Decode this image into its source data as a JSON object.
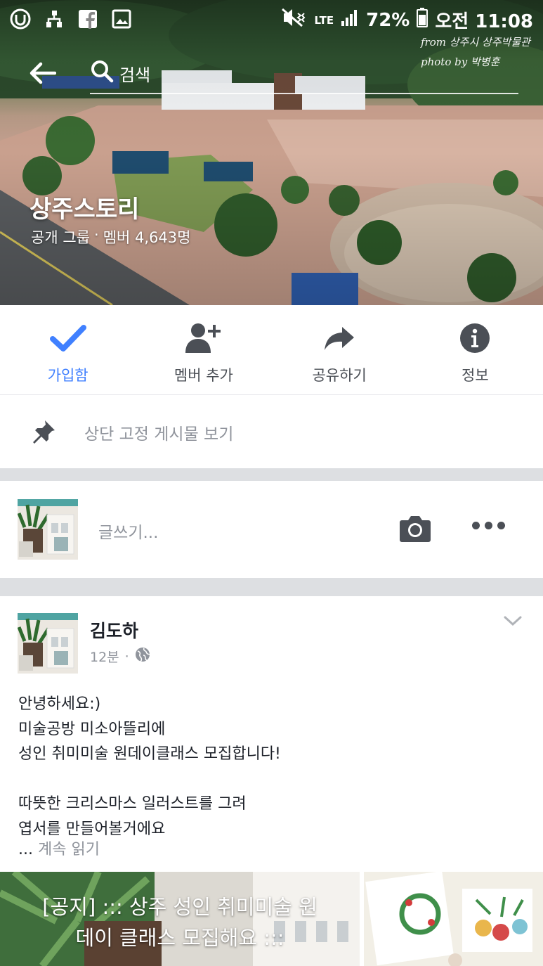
{
  "status_bar": {
    "network": "LTE",
    "battery": "72%",
    "time": "오전 11:08"
  },
  "cover": {
    "credit_line1": "from 상주시 상주박물관",
    "credit_line2": "photo by 박병훈"
  },
  "nav": {
    "search_label": "검색"
  },
  "group": {
    "name": "상주스토리",
    "privacy": "공개 그룹",
    "separator": "·",
    "members": "멤버 4,643명"
  },
  "actions": [
    {
      "label": "가입함",
      "icon": "check-icon",
      "active": true
    },
    {
      "label": "멤버 추가",
      "icon": "add-member-icon",
      "active": false
    },
    {
      "label": "공유하기",
      "icon": "share-icon",
      "active": false
    },
    {
      "label": "정보",
      "icon": "info-icon",
      "active": false
    }
  ],
  "pinned": {
    "label": "상단 고정 게시물 보기"
  },
  "composer": {
    "placeholder": "글쓰기..."
  },
  "post": {
    "author": "김도하",
    "time": "12분",
    "dot": "·",
    "lines": [
      "안녕하세요:)",
      "미술공방 미소아뜰리에",
      "성인 취미미술 원데이클래스 모집합니다!",
      "",
      "따뜻한 크리스마스 일러스트를 그려",
      "엽서를 만들어볼거에요"
    ],
    "ellipsis": "...",
    "read_more": "계속 읽기",
    "photo_caption_line1": "[공지] ::: 상주 성인 취미미술 원",
    "photo_caption_line2": "데이 클래스 모집해요 :::"
  },
  "colors": {
    "accent": "#4080ff",
    "icon_gray": "#4b4f56",
    "muted_text": "#90949c",
    "separator": "#dddfe2"
  }
}
